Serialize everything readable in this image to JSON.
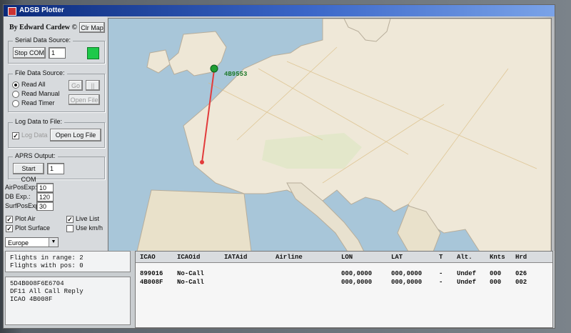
{
  "window": {
    "title": "ADSB Plotter"
  },
  "author": "By Edward Cardew ©",
  "buttons": {
    "clr_map": "Clr Map",
    "stop_com": "Stop COM",
    "go": "Go",
    "skip": "||",
    "open_file": "Open File",
    "open_log": "Open Log File",
    "start_com": "Start COM"
  },
  "serial": {
    "title": "Serial Data Source:",
    "com_port": "1"
  },
  "file_source": {
    "title": "File Data Source:",
    "options": [
      "Read All",
      "Read Manual",
      "Read Timer"
    ],
    "selected": "Read All"
  },
  "log": {
    "title": "Log Data to File:",
    "checkbox_label": "Log Data"
  },
  "aprs": {
    "title": "APRS Output:",
    "com_port": "1"
  },
  "settings": [
    {
      "label": "AirPosExp:",
      "value": "10"
    },
    {
      "label": "DB Exp.:",
      "value": "120"
    },
    {
      "label": "SurfPosExp:",
      "value": "30"
    }
  ],
  "options": {
    "plot_air": "Plot Air",
    "plot_surface": "Plot Surface",
    "live_list": "Live List",
    "use_kmh": "Use km/h"
  },
  "region": {
    "selected": "Europe"
  },
  "map": {
    "aircraft_label": "4B9553",
    "track_color": "#e23b3b",
    "aircraft_color": "#1f9e33"
  },
  "stats": {
    "line1": "Flights in range: 2",
    "line2": "Flights with pos: 0"
  },
  "log_box": {
    "line1": "5D4B008F6E6704",
    "line2": "DF11 All Call Reply",
    "line3": "ICAO 4B008F"
  },
  "table": {
    "columns": [
      "ICAO",
      "ICAOid",
      "IATAid",
      "Airline",
      "LON",
      "LAT",
      "T",
      "Alt.",
      "Knts",
      "Hrd"
    ],
    "rows": [
      [
        "899016",
        "No-Call",
        "",
        "",
        "000,0000",
        "000,0000",
        "-",
        "Undef",
        "000",
        "026"
      ],
      [
        "4B008F",
        "No-Call",
        "",
        "",
        "000,0000",
        "000,0000",
        "-",
        "Undef",
        "000",
        "002"
      ]
    ]
  }
}
